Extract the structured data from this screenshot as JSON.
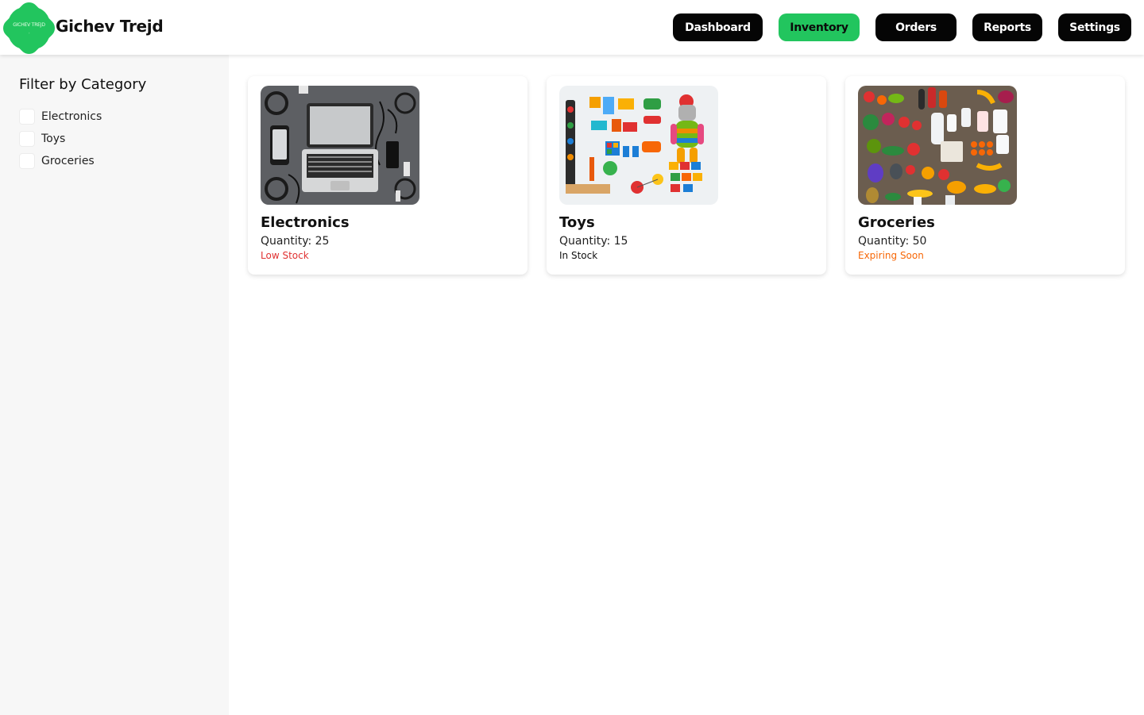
{
  "header": {
    "logo_text": "GICHEV TREJD",
    "brand": "Gichev Trejd",
    "nav": [
      {
        "label": "Dashboard",
        "active": false
      },
      {
        "label": "Inventory",
        "active": true
      },
      {
        "label": "Orders",
        "active": false
      },
      {
        "label": "Reports",
        "active": false
      },
      {
        "label": "Settings",
        "active": false
      }
    ]
  },
  "sidebar": {
    "title": "Filter by Category",
    "filters": [
      {
        "label": "Electronics",
        "checked": false
      },
      {
        "label": "Toys",
        "checked": false
      },
      {
        "label": "Groceries",
        "checked": false
      }
    ]
  },
  "cards": [
    {
      "title": "Electronics",
      "quantity": "Quantity: 25",
      "status": "Low Stock",
      "status_color": "#e03131",
      "image": "electronics-flatlay"
    },
    {
      "title": "Toys",
      "quantity": "Quantity: 15",
      "status": "In Stock",
      "status_color": "#111111",
      "image": "toys-flatlay"
    },
    {
      "title": "Groceries",
      "quantity": "Quantity: 50",
      "status": "Expiring Soon",
      "status_color": "#f76707",
      "image": "groceries-flatlay"
    }
  ],
  "colors": {
    "accent": "#22c55e",
    "nav_dark": "#050505"
  }
}
